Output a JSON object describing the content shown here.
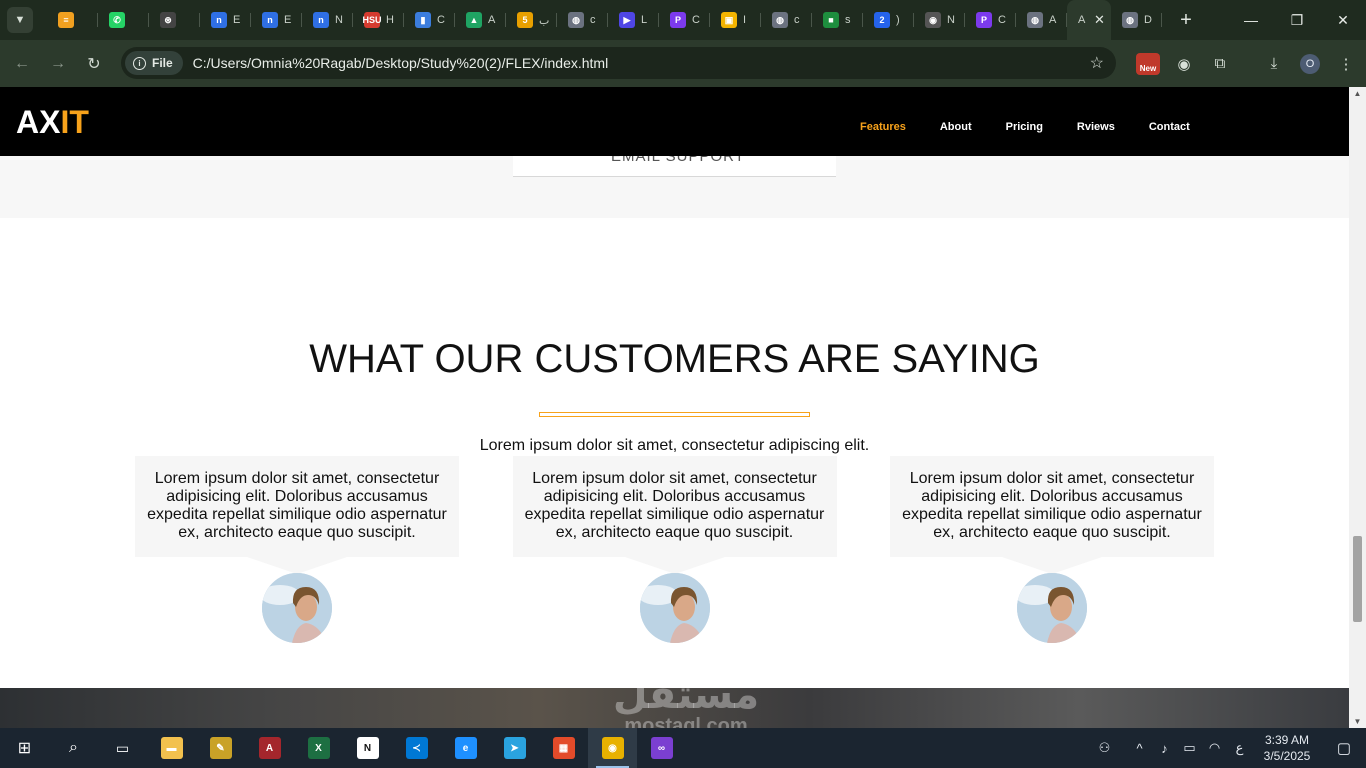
{
  "browser": {
    "tabs": [
      {
        "icon": "stacks-icon",
        "color": "#f0a020",
        "glyph": "≡",
        "title": ""
      },
      {
        "icon": "whatsapp-icon",
        "color": "#25d366",
        "glyph": "✆",
        "title": ""
      },
      {
        "icon": "openai-icon",
        "color": "#444444",
        "glyph": "⊛",
        "title": ""
      },
      {
        "icon": "notion-n-icon",
        "color": "#2f6fe4",
        "glyph": "n",
        "title": "E"
      },
      {
        "icon": "notion-n-icon",
        "color": "#2f6fe4",
        "glyph": "n",
        "title": "E"
      },
      {
        "icon": "notion-n-icon",
        "color": "#2f6fe4",
        "glyph": "n",
        "title": "N"
      },
      {
        "icon": "hsu-icon",
        "color": "#d63b2f",
        "glyph": "HSU",
        "title": "H"
      },
      {
        "icon": "chart-icon",
        "color": "#3b7ddd",
        "glyph": "▮",
        "title": "C"
      },
      {
        "icon": "drive-icon",
        "color": "#1fa463",
        "glyph": "▲",
        "title": "A"
      },
      {
        "icon": "five-icon",
        "color": "#e8a000",
        "glyph": "5",
        "title": "ب"
      },
      {
        "icon": "globe-icon",
        "color": "#6b7280",
        "glyph": "◍",
        "title": "c"
      },
      {
        "icon": "video-icon",
        "color": "#4f46e5",
        "glyph": "▶",
        "title": "L"
      },
      {
        "icon": "copilot-icon",
        "color": "#7c3aed",
        "glyph": "P",
        "title": "C"
      },
      {
        "icon": "slides-icon",
        "color": "#f4b400",
        "glyph": "▣",
        "title": "I"
      },
      {
        "icon": "globe-icon",
        "color": "#6b7280",
        "glyph": "◍",
        "title": "c"
      },
      {
        "icon": "classroom-icon",
        "color": "#1e8e3e",
        "glyph": "■",
        "title": "s"
      },
      {
        "icon": "quiz-icon",
        "color": "#2563eb",
        "glyph": "2",
        "title": ")"
      },
      {
        "icon": "chrome-icon",
        "color": "#555555",
        "glyph": "◉",
        "title": "N"
      },
      {
        "icon": "copilot-icon",
        "color": "#7c3aed",
        "glyph": "P",
        "title": "C"
      },
      {
        "icon": "globe-icon",
        "color": "#6b7280",
        "glyph": "◍",
        "title": "A"
      }
    ],
    "active_tab_title": "A",
    "last_tab": {
      "icon": "globe-icon",
      "color": "#6b7280",
      "glyph": "◍",
      "title": "D"
    },
    "chip_label": "File",
    "url": "C:/Users/Omnia%20Ragab/Desktop/Study%20(2)/FLEX/index.html",
    "ext_new_label": "New",
    "profile_initial": "O"
  },
  "site": {
    "logo_main": "AX",
    "logo_accent": "IT",
    "accent_color": "#f7a21b",
    "nav": [
      {
        "label": "Features",
        "active": true
      },
      {
        "label": "About",
        "active": false
      },
      {
        "label": "Pricing",
        "active": false
      },
      {
        "label": "Rviews",
        "active": false
      },
      {
        "label": "Contact",
        "active": false
      }
    ],
    "prev_card_label": "EMAIL SUPPORT",
    "section_title": "WHAT OUR CUSTOMERS ARE SAYING",
    "section_subtitle": "Lorem ipsum dolor sit amet, consectetur adipiscing elit.",
    "testimonials": [
      {
        "text": "Lorem ipsum dolor sit amet, consectetur adipisicing elit. Doloribus accusamus expedita repellat similique odio aspernatur ex, architecto eaque quo suscipit."
      },
      {
        "text": "Lorem ipsum dolor sit amet, consectetur adipisicing elit. Doloribus accusamus expedita repellat similique odio aspernatur ex, architecto eaque quo suscipit."
      },
      {
        "text": "Lorem ipsum dolor sit amet, consectetur adipisicing elit. Doloribus accusamus expedita repellat similique odio aspernatur ex, architecto eaque quo suscipit."
      }
    ],
    "watermark_arabic": "مستقل",
    "watermark_latin": "mostaql.com"
  },
  "taskbar": {
    "apps": [
      {
        "icon": "file-explorer-icon",
        "color": "#f2c14e",
        "glyph": "▬"
      },
      {
        "icon": "photos-icon",
        "color": "#c9a227",
        "glyph": "✎"
      },
      {
        "icon": "access-icon",
        "color": "#a4262c",
        "glyph": "A"
      },
      {
        "icon": "excel-icon",
        "color": "#1d6f42",
        "glyph": "X"
      },
      {
        "icon": "notion-icon",
        "color": "#ffffff",
        "glyph": "N"
      },
      {
        "icon": "vscode-icon",
        "color": "#0078d4",
        "glyph": "≺"
      },
      {
        "icon": "edge-icon",
        "color": "#1e90ff",
        "glyph": "e"
      },
      {
        "icon": "telegram-icon",
        "color": "#2aa3df",
        "glyph": "➤"
      },
      {
        "icon": "winapp-icon",
        "color": "#e34b2a",
        "glyph": "▦"
      },
      {
        "icon": "chrome-icon",
        "color": "#e8b100",
        "glyph": "◉"
      },
      {
        "icon": "visual-studio-icon",
        "color": "#7b3fd1",
        "glyph": "∞"
      }
    ],
    "lang": "ع",
    "time": "3:39 AM",
    "date": "3/5/2025"
  }
}
